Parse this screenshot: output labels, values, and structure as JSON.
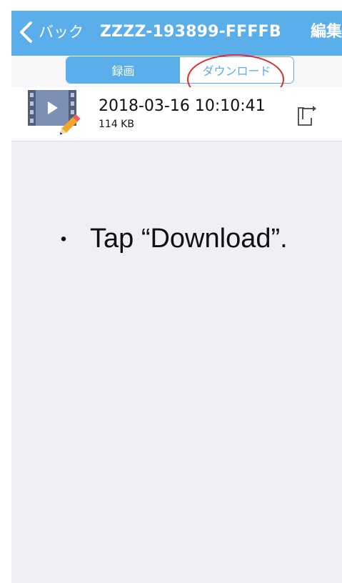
{
  "navbar": {
    "back_label": "バック",
    "title": "ZZZZ-193899-FFFFB",
    "edit_label": "編集"
  },
  "segmented": {
    "tabs": [
      {
        "label": "録画",
        "selected": true
      },
      {
        "label": "ダウンロード",
        "selected": false
      }
    ]
  },
  "files": [
    {
      "title": "2018-03-16  10:10:41",
      "size": "114 KB",
      "icon": "video-edit-icon"
    }
  ],
  "instruction": {
    "bullet": "・",
    "text": "Tap “Download”."
  },
  "colors": {
    "accent": "#5aaeea",
    "highlight": "#e5262a",
    "background": "#efeff4"
  }
}
